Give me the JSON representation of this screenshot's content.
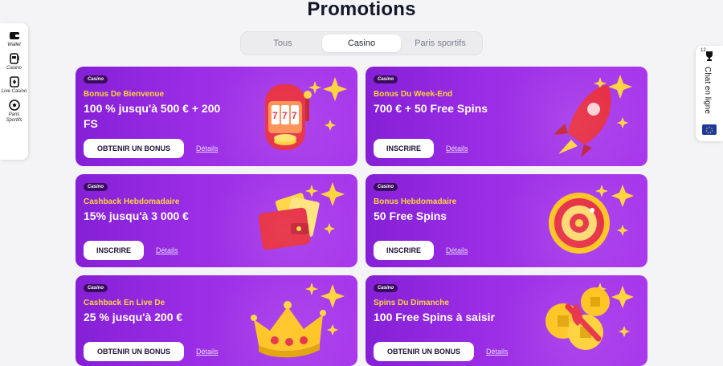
{
  "page": {
    "title": "Promotions"
  },
  "tabs": [
    {
      "label": "Tous",
      "active": false
    },
    {
      "label": "Casino",
      "active": true
    },
    {
      "label": "Paris sportifs",
      "active": false
    }
  ],
  "sidebar": {
    "items": [
      {
        "label": "Wallet",
        "icon": "wallet-icon"
      },
      {
        "label": "Casino",
        "icon": "slot-machine-icon"
      },
      {
        "label": "Live Casino",
        "icon": "cards-icon"
      },
      {
        "label": "Paris Sportifs",
        "icon": "soccer-ball-icon"
      }
    ]
  },
  "chat": {
    "label": "Chat en ligne",
    "count": "12",
    "icon": "trophy-icon",
    "flag": "eu-flag-icon"
  },
  "promos": [
    {
      "badge": "Casino",
      "subtitle": "Bonus De Bienvenue",
      "headline": "100 % jusqu'à 500 € + 200 FS",
      "cta": "OBTENIR UN BONUS",
      "details": "Détails",
      "art": "slot-machine-art"
    },
    {
      "badge": "Casino",
      "subtitle": "Bonus Du Week-End",
      "headline": "700 € + 50 Free Spins",
      "cta": "INSCRIRE",
      "details": "Détails",
      "art": "rocket-art"
    },
    {
      "badge": "Casino",
      "subtitle": "Cashback Hebdomadaire",
      "headline": "15% jusqu'à 3 000 €",
      "cta": "INSCRIRE",
      "details": "Détails",
      "art": "wallet-art"
    },
    {
      "badge": "Casino",
      "subtitle": "Bonus Hebdomadaire",
      "headline": "50 Free Spins",
      "cta": "INSCRIRE",
      "details": "Détails",
      "art": "roulette-art"
    },
    {
      "badge": "Casino",
      "subtitle": "Cashback En Live De",
      "headline": "25 % jusqu'à 200 €",
      "cta": "OBTENIR UN BONUS",
      "details": "Détails",
      "art": "crown-art"
    },
    {
      "badge": "Casino",
      "subtitle": "Spins Du Dimanche",
      "headline": "100 Free Spins à saisir",
      "cta": "OBTENIR UN BONUS",
      "details": "Détails",
      "art": "coins-art"
    }
  ],
  "colors": {
    "card_gradient_start": "#8520d6",
    "card_gradient_end": "#a938ec",
    "subtitle": "#ffd43b",
    "title": "#14162b"
  }
}
